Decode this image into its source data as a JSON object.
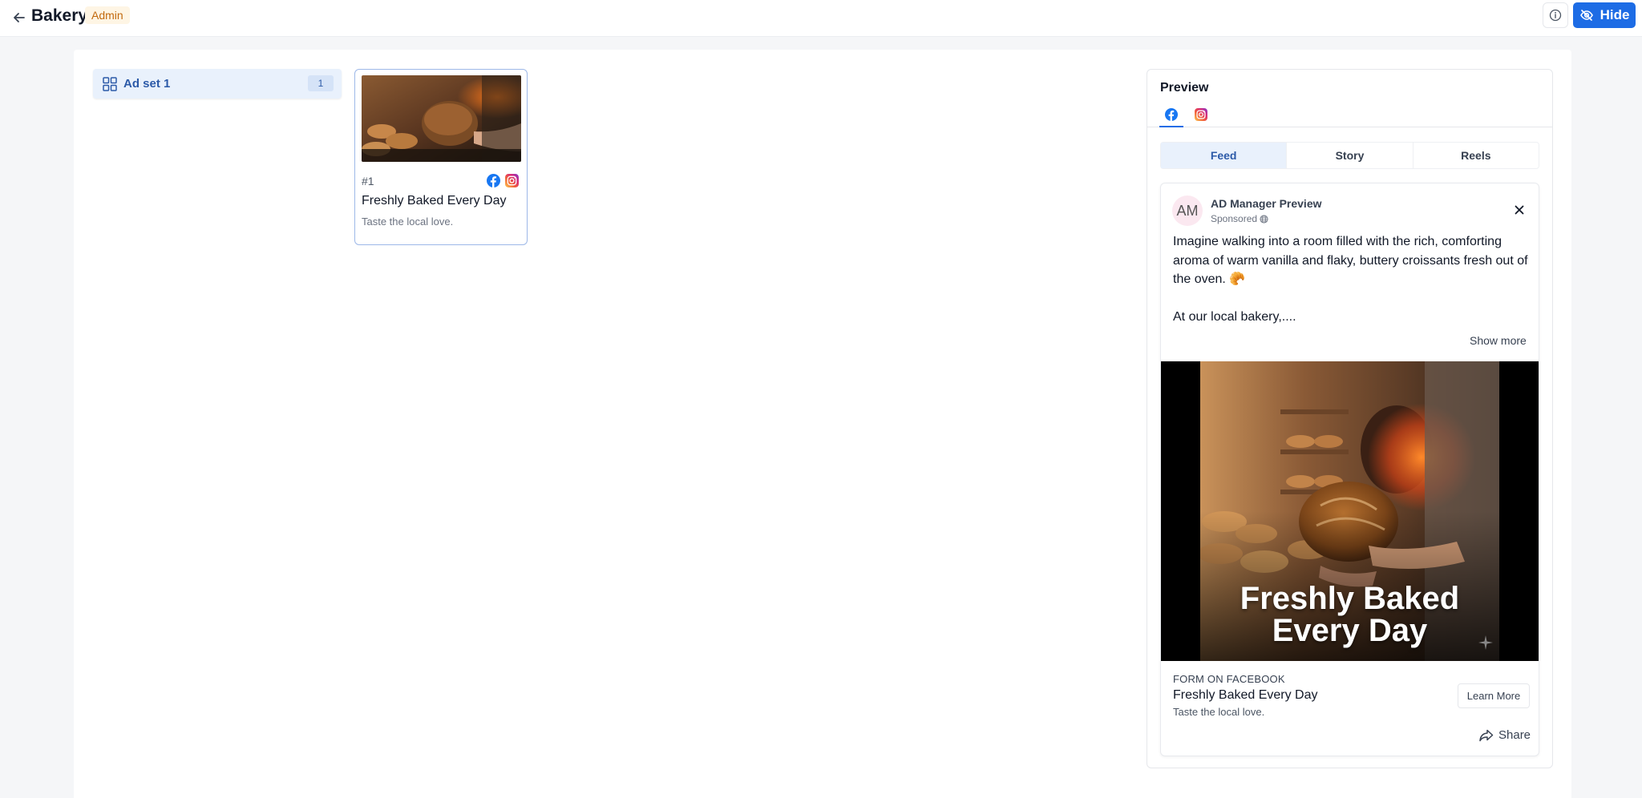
{
  "header": {
    "title": "Bakery",
    "role_badge": "Admin",
    "hide_label": "Hide"
  },
  "ad_sets": [
    {
      "label": "Ad set 1",
      "count": "1"
    }
  ],
  "ads": [
    {
      "number": "#1",
      "title": "Freshly Baked Every Day",
      "description": "Taste the local love."
    }
  ],
  "preview": {
    "title": "Preview",
    "platforms": [
      "facebook-icon",
      "instagram-icon"
    ],
    "format_tabs": [
      "Feed",
      "Story",
      "Reels"
    ],
    "active_format": "Feed",
    "post": {
      "avatar_initials": "AM",
      "page_name": "AD Manager Preview",
      "sponsored": "Sponsored",
      "text_line1": "Imagine walking into a room filled with the rich, comforting aroma of warm vanilla and flaky, buttery croissants fresh out of the oven. 🥐",
      "text_line2": "At our local bakery,....",
      "show_more": "Show more",
      "media_headline_line1": "Freshly Baked",
      "media_headline_line2": "Every Day",
      "cta_caption": "FORM ON FACEBOOK",
      "cta_title": "Freshly Baked Every Day",
      "cta_description": "Taste the local love.",
      "cta_button": "Learn More",
      "share_label": "Share"
    }
  },
  "colors": {
    "accent": "#1d6ce5",
    "badge_text": "#c2690d",
    "badge_bg": "#fef5e4",
    "selected_bg": "#e9f1fc"
  }
}
